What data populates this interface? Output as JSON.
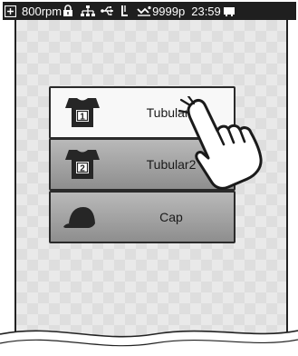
{
  "status_bar": {
    "speed": "800rpm",
    "stitch_count": "9999p",
    "time": "23:59",
    "icons": [
      "frame-icon",
      "lock-icon",
      "network-icon",
      "usb-icon",
      "needle-icon",
      "stitch-icon",
      "embroidery-icon"
    ]
  },
  "menu": {
    "items": [
      {
        "label": "Tubular1",
        "icon": "tshirt-1-icon",
        "badge": "1",
        "state": "selected"
      },
      {
        "label": "Tubular2",
        "icon": "tshirt-2-icon",
        "badge": "2",
        "state": "normal"
      },
      {
        "label": "Cap",
        "icon": "cap-icon",
        "state": "normal"
      }
    ]
  },
  "overlay": {
    "icon": "pointing-hand-icon"
  }
}
